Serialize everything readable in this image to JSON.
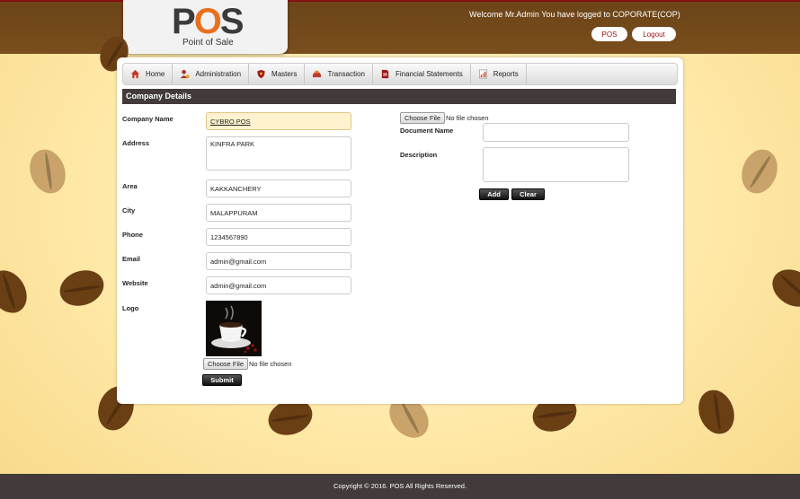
{
  "header": {
    "logo_main": "POS",
    "logo_sub": "Point of Sale",
    "welcome": "Welcome Mr.Admin You have logged to COPORATE(COP)",
    "pos_button": "POS",
    "logout_button": "Logout"
  },
  "nav": {
    "items": [
      {
        "label": "Home",
        "icon": "home-icon"
      },
      {
        "label": "Administration",
        "icon": "user-icon"
      },
      {
        "label": "Masters",
        "icon": "shield-icon"
      },
      {
        "label": "Transaction",
        "icon": "tray-icon"
      },
      {
        "label": "Financial Statements",
        "icon": "document-icon"
      },
      {
        "label": "Reports",
        "icon": "report-icon"
      }
    ]
  },
  "section_title": "Company Details",
  "form": {
    "company_name_label": "Company Name",
    "company_name_value": "CYBRO POS",
    "address_label": "Address",
    "address_value": "KINFRA PARK",
    "area_label": "Area",
    "area_value": "KAKKANCHERY",
    "city_label": "City",
    "city_value": "MALAPPURAM",
    "phone_label": "Phone",
    "phone_value": "1234567890",
    "email_label": "Email",
    "email_value": "admin@gmail.com",
    "website_label": "Website",
    "website_value": "admin@gmail.com",
    "logo_label": "Logo",
    "choose_file": "Choose File",
    "no_file": "No file chosen",
    "submit": "Submit"
  },
  "document": {
    "choose_file": "Choose File",
    "no_file": "No file chosen",
    "document_name_label": "Document Name",
    "document_name_value": "",
    "description_label": "Description",
    "description_value": "",
    "add": "Add",
    "clear": "Clear"
  },
  "footer": "Copyright © 2016. POS All Rights Reserved."
}
